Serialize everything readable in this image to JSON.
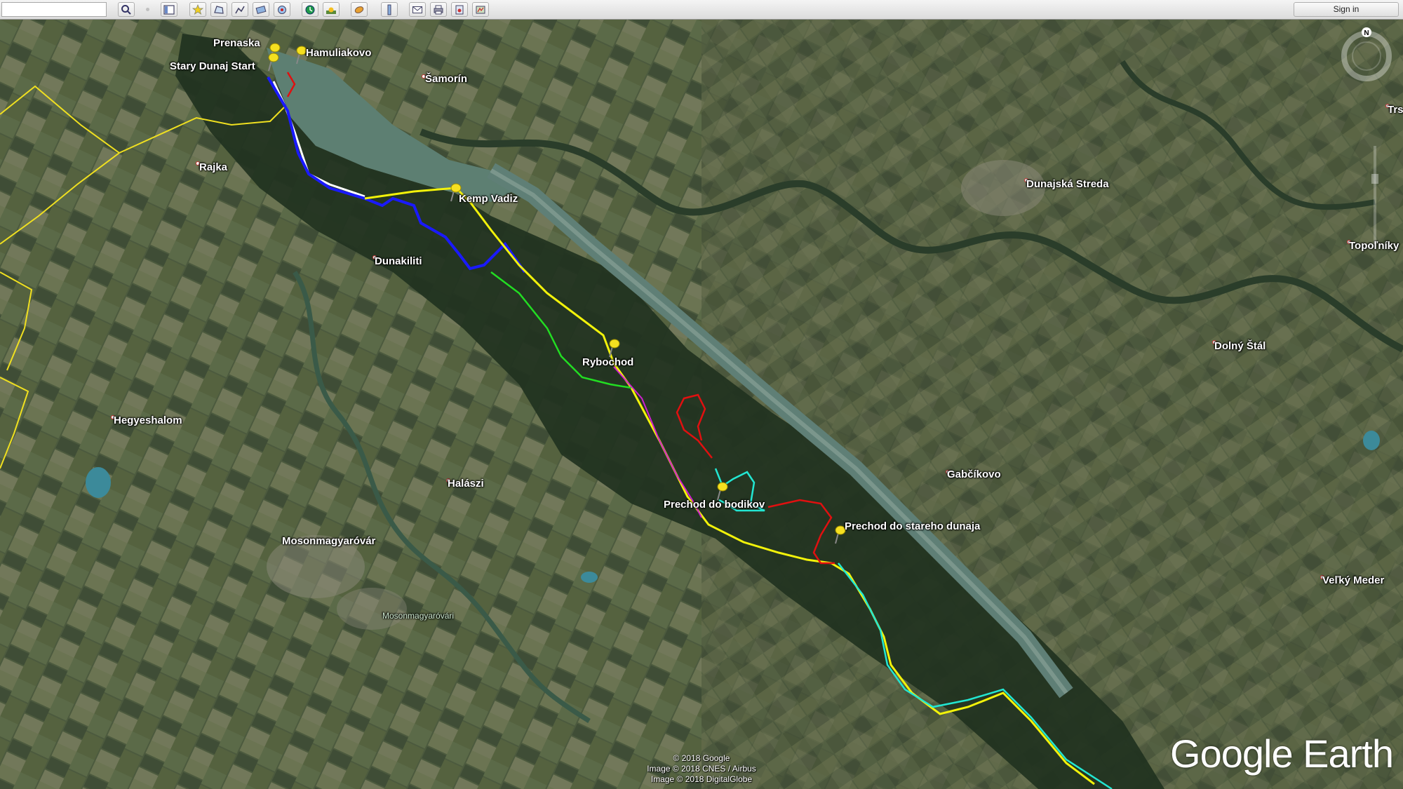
{
  "toolbar": {
    "search_value": "",
    "icons": [
      "search-icon",
      "sidebar-toggle-icon",
      "add-placemark-icon",
      "add-polygon-icon",
      "add-path-icon",
      "add-overlay-icon",
      "record-tour-icon",
      "historical-imagery-icon",
      "sunlight-icon",
      "switch-to-sky-icon",
      "ruler-icon",
      "email-icon",
      "print-icon",
      "save-image-icon",
      "view-in-maps-icon"
    ],
    "sign_in_label": "Sign in"
  },
  "map": {
    "places": {
      "prenaska": "Prenaska",
      "hamuliakovo": "Hamuliakovo",
      "stary_dunaj_start": "Stary Dunaj Start",
      "samorin": "Šamorín",
      "rajka": "Rajka",
      "kemp_vadiz": "Kemp Vadiz",
      "dunakiliti": "Dunakiliti",
      "dunajska_streda": "Dunajská Streda",
      "topolniky": "Topoľníky",
      "trs": "Trs",
      "rybochod": "Rybochod",
      "dolny_stal": "Dolný Štál",
      "hegyeshalom": "Hegyeshalom",
      "halaszi": "Halászi",
      "gabcikovo": "Gabčíkovo",
      "prechod_do_bodikov": "Prechod do bodikov",
      "prechod_do_stareho_dunaja": "Prechod do stareho dunaja",
      "mosonmagyarovar": "Mosonmagyaróvár",
      "mosonmagyarovar_river": "Mosonmagyaróvári",
      "velky_meder": "Veľký Meder"
    },
    "compass_letter": "N",
    "route_colors": {
      "blue": "#1a1aff",
      "yellow": "#f2f20a",
      "red": "#e01010",
      "green": "#22dd22",
      "cyan": "#22e6d2",
      "magenta": "#d020d0",
      "white": "#ffffff",
      "border": "#f0e020"
    }
  },
  "attribution": {
    "line1": "© 2018 Google",
    "line2": "Image © 2018 CNES / Airbus",
    "line3": "Image © 2018 DigitalGlobe"
  },
  "brand": "Google Earth"
}
